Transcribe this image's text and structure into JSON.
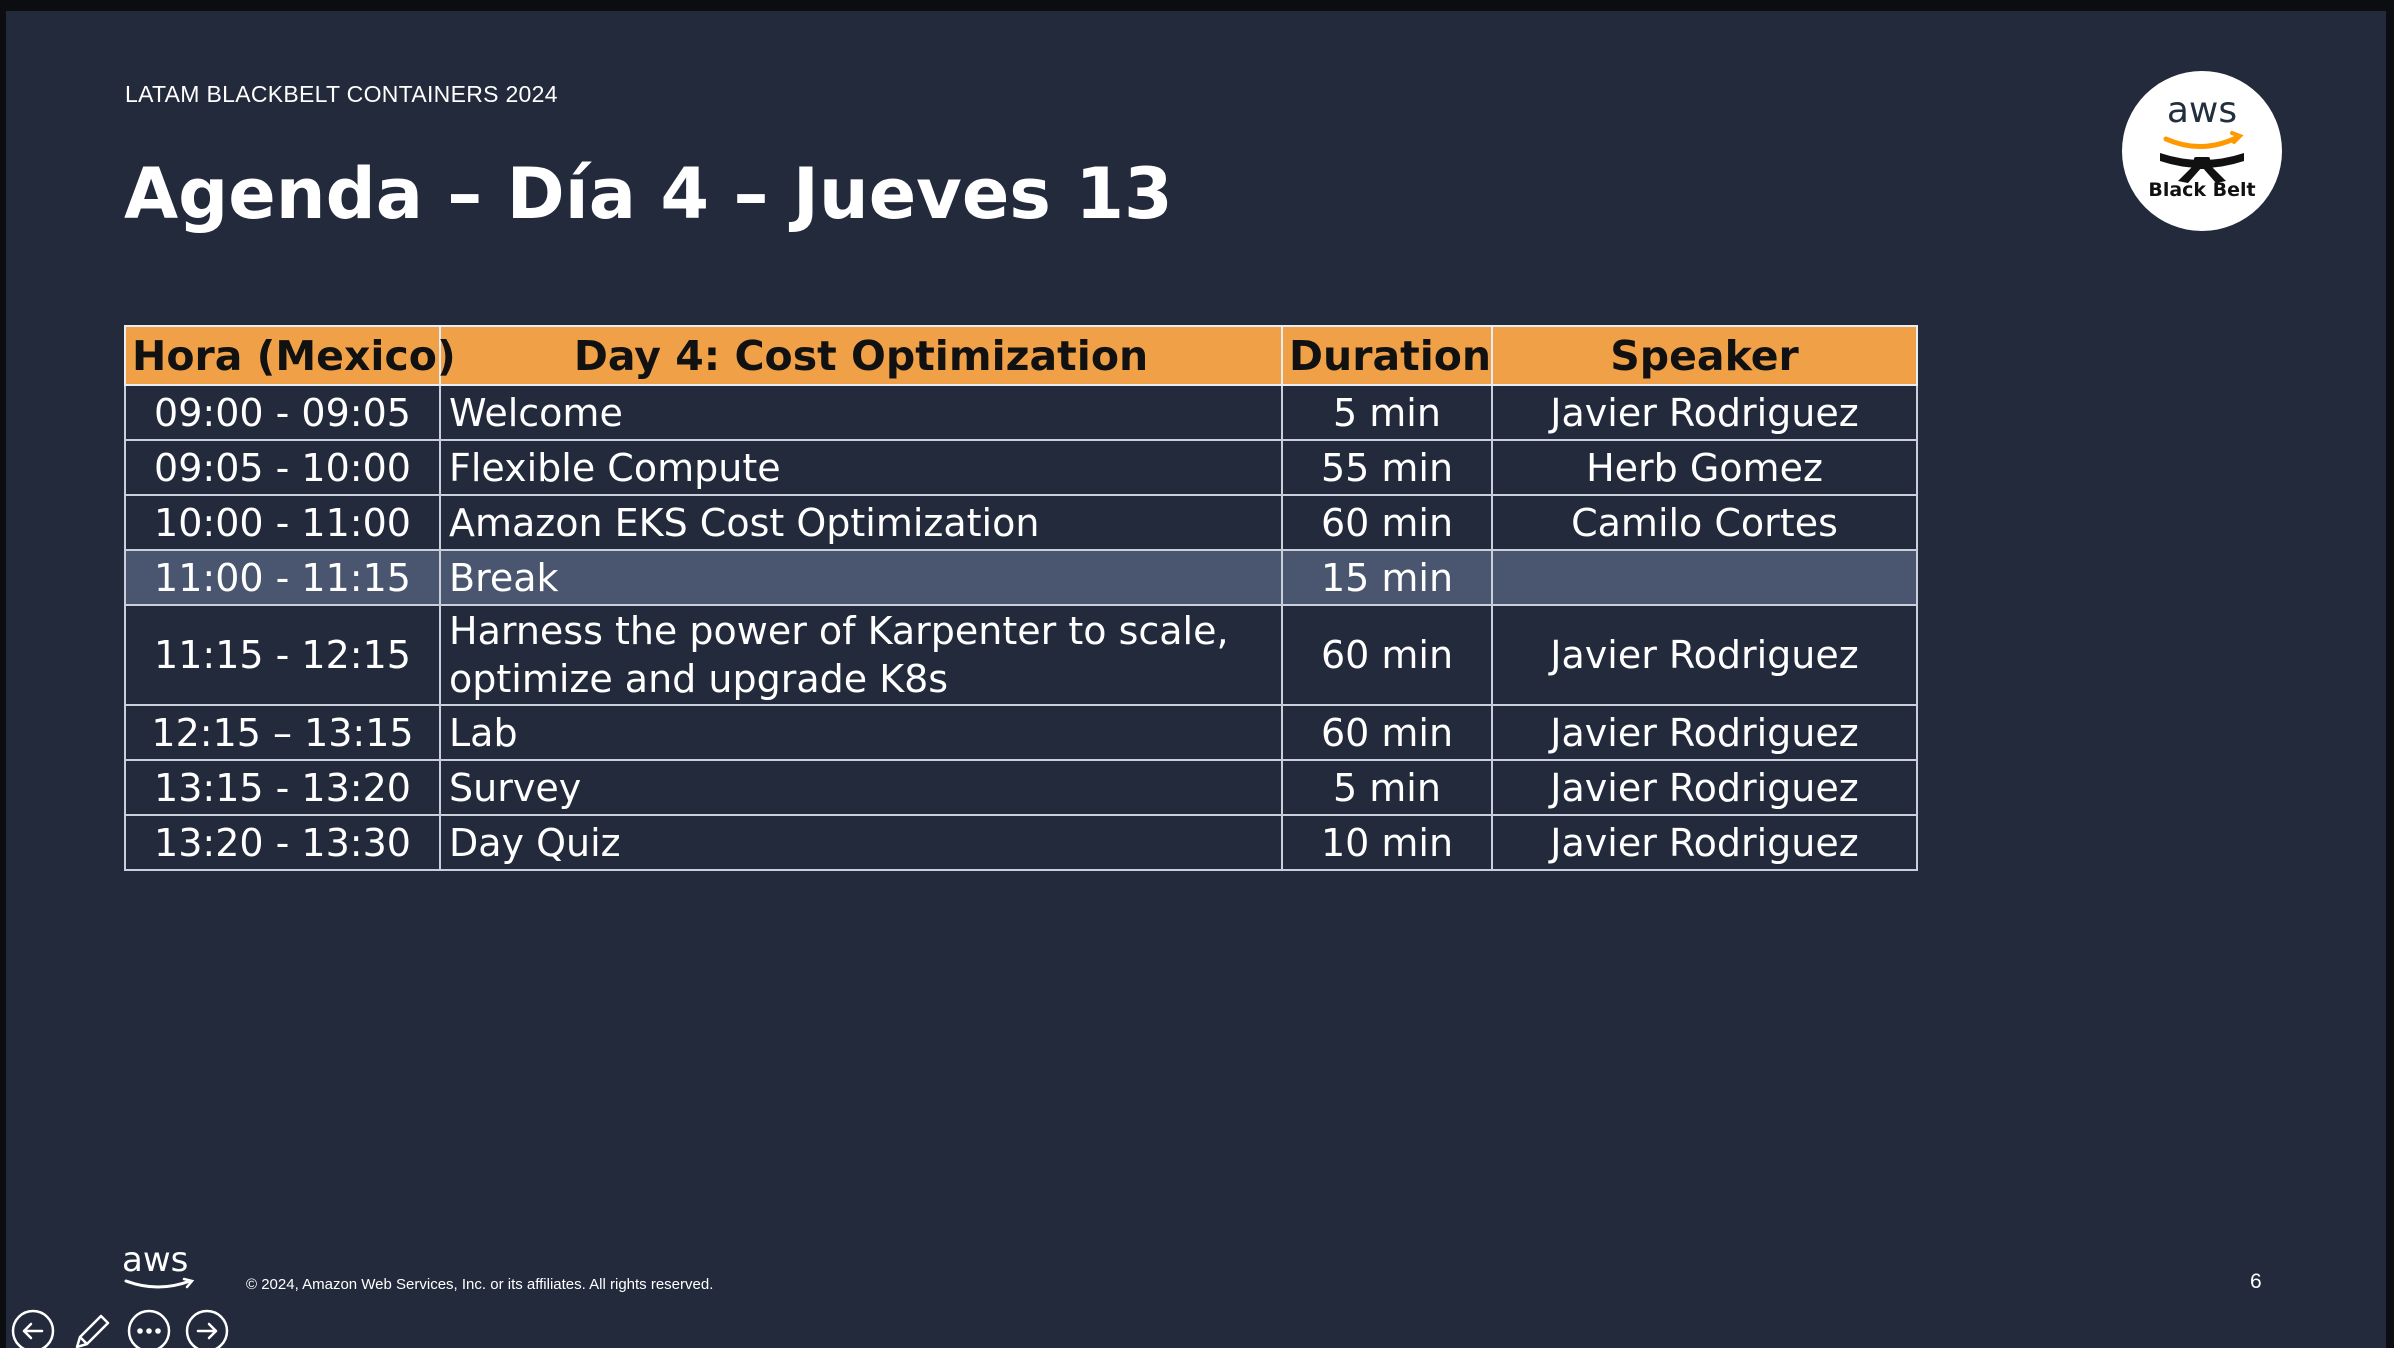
{
  "slide": {
    "event_label": "LATAM BLACKBELT CONTAINERS 2024",
    "title": "Agenda – Día 4 – Jueves 13",
    "page_number": "6",
    "copyright": "© 2024, Amazon Web Services, Inc. or its affiliates. All rights reserved.",
    "badge": {
      "brand": "aws",
      "caption": "Black Belt",
      "icon": "black-belt-icon"
    },
    "footer_logo": "aws"
  },
  "agenda": {
    "headers": [
      "Hora (Mexico)",
      "Day 4: Cost Optimization",
      "Duration",
      "Speaker"
    ],
    "rows": [
      {
        "time": "09:00 - 09:05",
        "topic": "Welcome",
        "duration": "5 min",
        "speaker": "Javier Rodriguez"
      },
      {
        "time": "09:05 - 10:00",
        "topic": "Flexible Compute",
        "duration": "55 min",
        "speaker": "Herb Gomez"
      },
      {
        "time": "10:00 - 11:00",
        "topic": "Amazon EKS Cost Optimization",
        "duration": "60 min",
        "speaker": "Camilo Cortes"
      },
      {
        "time": "11:00 - 11:15",
        "topic": "Break",
        "duration": "15 min",
        "speaker": ""
      },
      {
        "time": "11:15 - 12:15",
        "topic": "Harness the power of Karpenter to scale, optimize and upgrade K8s",
        "duration": "60 min",
        "speaker": "Javier Rodriguez"
      },
      {
        "time": "12:15 – 13:15",
        "topic": "Lab",
        "duration": "60 min",
        "speaker": "Javier Rodriguez"
      },
      {
        "time": "13:15 - 13:20",
        "topic": "Survey",
        "duration": "5 min",
        "speaker": "Javier Rodriguez"
      },
      {
        "time": "13:20 - 13:30",
        "topic": "Day Quiz",
        "duration": "10 min",
        "speaker": "Javier Rodriguez"
      }
    ]
  },
  "controls": {
    "previous": "arrow-left-icon",
    "pen": "pen-icon",
    "more": "more-options-icon",
    "next": "arrow-right-icon"
  },
  "colors": {
    "slide_background": "#232a3c",
    "header_fill": "#f0a147",
    "highlight_row": "#4a566f",
    "aws_orange": "#ff9900"
  }
}
